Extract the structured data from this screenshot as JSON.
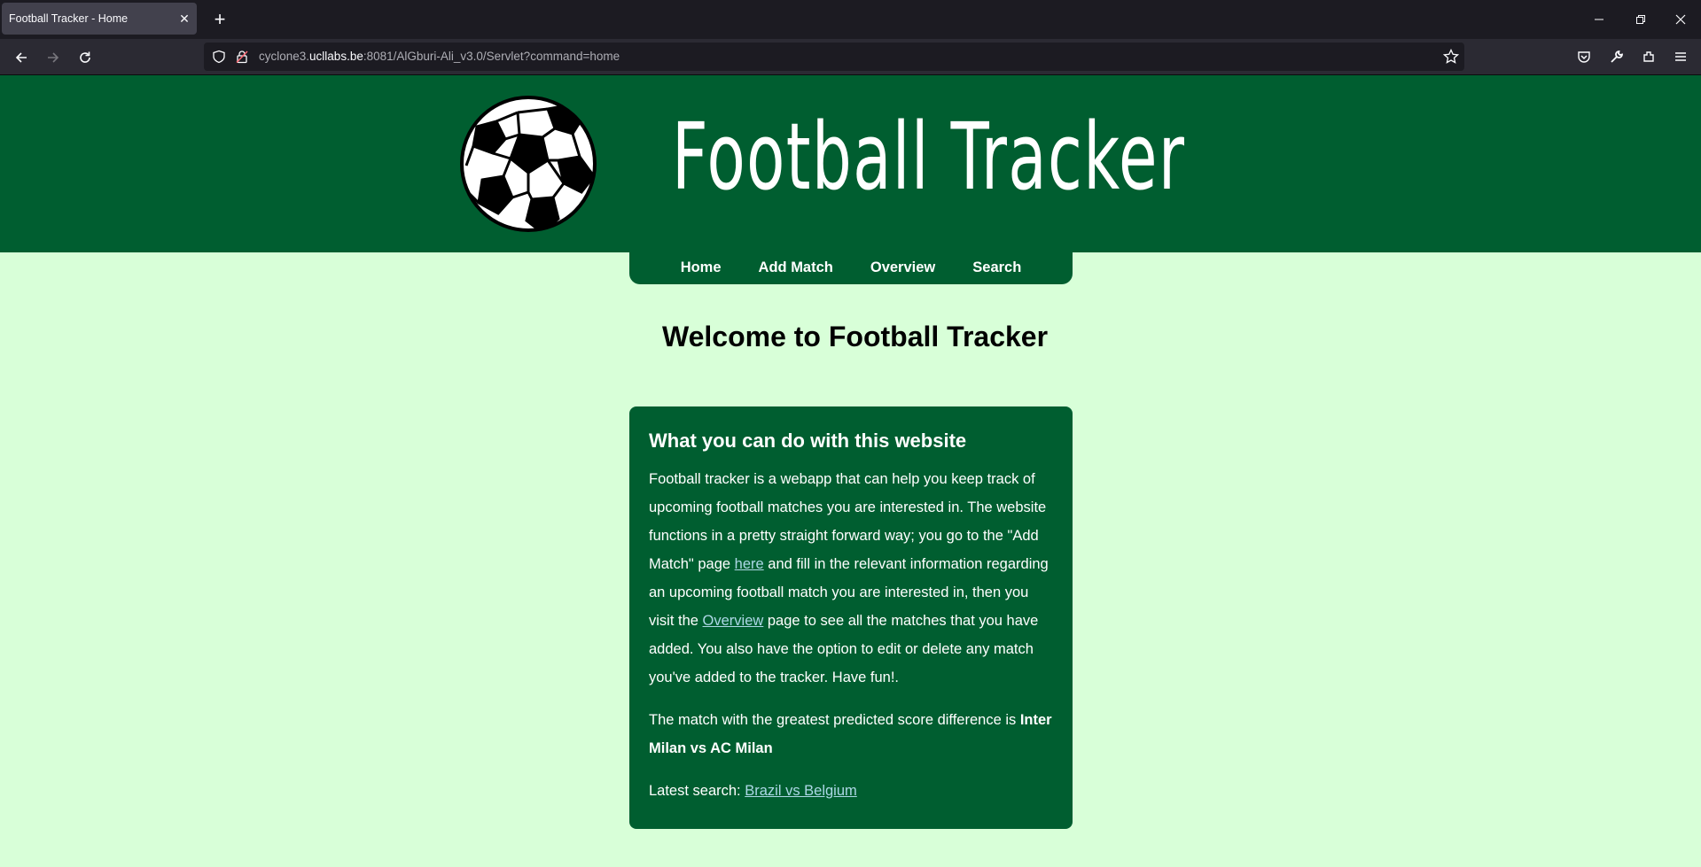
{
  "browser": {
    "tab_title": "Football Tracker - Home",
    "url_prefix": "cyclone3.",
    "url_domain": "ucllabs.be",
    "url_rest": ":8081/AlGburi-Ali_v3.0/Servlet?command=home"
  },
  "site": {
    "title": "Football Tracker",
    "nav": {
      "home": "Home",
      "add_match": "Add Match",
      "overview": "Overview",
      "search": "Search"
    },
    "welcome": "Welcome to Football Tracker"
  },
  "card": {
    "heading": "What you can do with this website",
    "intro_1": "Football tracker is a webapp that can help you keep track of upcoming football matches you are interested in. The website functions in a pretty straight forward way; you go to the \"Add Match\" page ",
    "link_here": "here",
    "intro_2": " and fill in the relevant information regarding an upcoming football match you are interested in, then you visit the ",
    "link_overview": "Overview",
    "intro_3": " page to see all the matches that you have added. You also have the option to edit or delete any match you've added to the tracker. Have fun!.",
    "diff_text": "The match with the greatest predicted score difference is ",
    "diff_match": "Inter Milan vs AC Milan",
    "latest_label": "Latest search: ",
    "latest_link": "Brazil vs Belgium"
  },
  "colors": {
    "brand_green": "#005e30",
    "page_bg": "#d8ffd8",
    "link": "#add8e6"
  }
}
